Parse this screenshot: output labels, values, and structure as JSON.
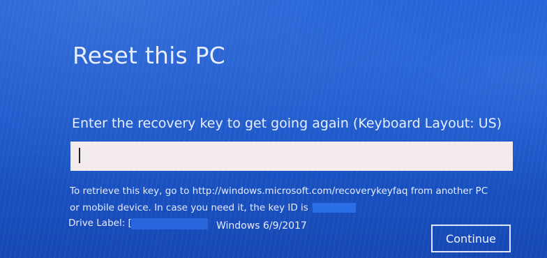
{
  "page": {
    "title": "Reset this PC",
    "prompt": "Enter the recovery key to get going again (Keyboard Layout: US)",
    "recovery_key_input": {
      "value": "",
      "placeholder": ""
    },
    "info_line_1": "To retrieve this key, go to http://windows.microsoft.com/recoverykeyfaq from another PC",
    "info_line_2": "or mobile device. In case you need it, the key ID is",
    "drive_label_caption": "Drive Label: [",
    "drive_label_value": "Windows 6/9/2017",
    "continue_label": "Continue"
  },
  "colors": {
    "background": "#1b58cc",
    "input_background": "#f4ecec",
    "text": "#e8eeff"
  }
}
